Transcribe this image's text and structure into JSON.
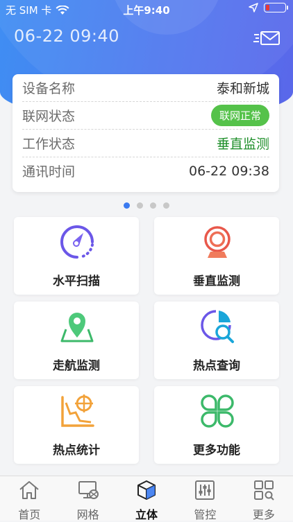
{
  "status_bar": {
    "carrier": "无 SIM 卡",
    "time": "上午9:40"
  },
  "header": {
    "datetime": "06-22 09:40"
  },
  "device_info": {
    "rows": [
      {
        "label": "设备名称",
        "value": "泰和新城"
      },
      {
        "label": "联网状态",
        "value": "联网正常"
      },
      {
        "label": "工作状态",
        "value": "垂直监测"
      },
      {
        "label": "通讯时间",
        "value": "06-22 09:38"
      }
    ]
  },
  "carousel": {
    "page_count": 4,
    "active_index": 0
  },
  "features": [
    {
      "label": "水平扫描",
      "icon": "gauge-icon"
    },
    {
      "label": "垂直监测",
      "icon": "webcam-icon"
    },
    {
      "label": "走航监测",
      "icon": "map-pin-icon"
    },
    {
      "label": "热点查询",
      "icon": "pie-search-icon"
    },
    {
      "label": "热点统计",
      "icon": "target-chart-icon"
    },
    {
      "label": "更多功能",
      "icon": "clover-icon"
    }
  ],
  "tabbar": {
    "items": [
      {
        "label": "首页",
        "icon": "home-icon"
      },
      {
        "label": "网格",
        "icon": "monitor-grid-icon"
      },
      {
        "label": "立体",
        "icon": "cube-icon",
        "active": true
      },
      {
        "label": "管控",
        "icon": "sliders-icon"
      },
      {
        "label": "更多",
        "icon": "apps-icon"
      }
    ]
  },
  "colors": {
    "header_gradient_start": "#3f8ef3",
    "header_gradient_end": "#5a67ea",
    "badge_green": "#55c24a",
    "status_green": "#1e8f2a",
    "active_dot": "#3a7af0"
  }
}
